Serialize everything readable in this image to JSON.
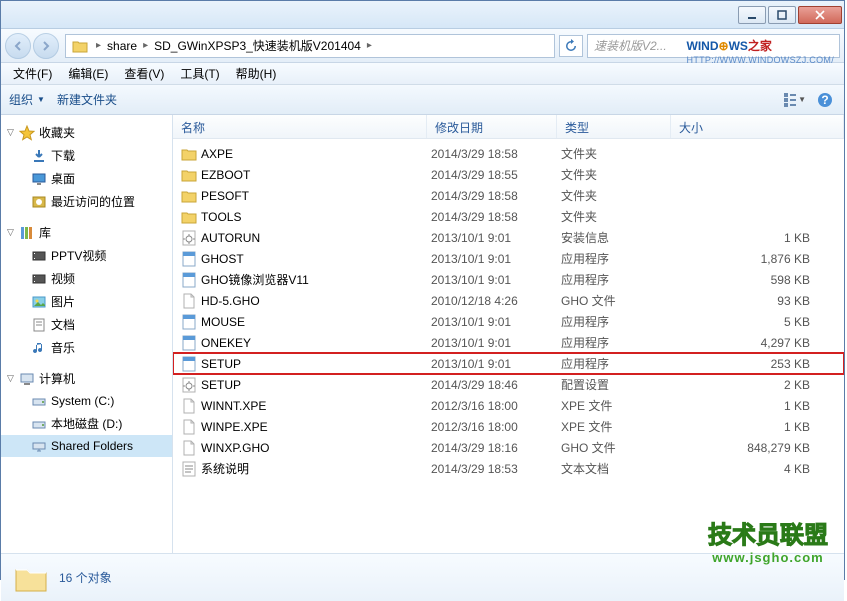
{
  "breadcrumb": {
    "items": [
      "share",
      "SD_GWinXPSP3_快速装机版V201404"
    ],
    "search_placeholder": "速装机版V2..."
  },
  "menubar": [
    "文件(F)",
    "编辑(E)",
    "查看(V)",
    "工具(T)",
    "帮助(H)"
  ],
  "toolbar": {
    "organize": "组织",
    "new_folder": "新建文件夹"
  },
  "sidebar": {
    "groups": [
      {
        "label": "收藏夹",
        "icon": "star",
        "items": [
          {
            "label": "下载",
            "icon": "download"
          },
          {
            "label": "桌面",
            "icon": "desktop"
          },
          {
            "label": "最近访问的位置",
            "icon": "recent"
          }
        ]
      },
      {
        "label": "库",
        "icon": "library",
        "items": [
          {
            "label": "PPTV视频",
            "icon": "video"
          },
          {
            "label": "视频",
            "icon": "video"
          },
          {
            "label": "图片",
            "icon": "picture"
          },
          {
            "label": "文档",
            "icon": "document"
          },
          {
            "label": "音乐",
            "icon": "music"
          }
        ]
      },
      {
        "label": "计算机",
        "icon": "computer",
        "items": [
          {
            "label": "System (C:)",
            "icon": "drive"
          },
          {
            "label": "本地磁盘 (D:)",
            "icon": "drive"
          },
          {
            "label": "Shared Folders",
            "icon": "netdrive",
            "selected": true
          }
        ]
      }
    ]
  },
  "columns": {
    "name": "名称",
    "date": "修改日期",
    "type": "类型",
    "size": "大小"
  },
  "files": [
    {
      "name": "AXPE",
      "date": "2014/3/29 18:58",
      "type": "文件夹",
      "size": "",
      "icon": "folder"
    },
    {
      "name": "EZBOOT",
      "date": "2014/3/29 18:55",
      "type": "文件夹",
      "size": "",
      "icon": "folder"
    },
    {
      "name": "PESOFT",
      "date": "2014/3/29 18:58",
      "type": "文件夹",
      "size": "",
      "icon": "folder"
    },
    {
      "name": "TOOLS",
      "date": "2014/3/29 18:58",
      "type": "文件夹",
      "size": "",
      "icon": "folder"
    },
    {
      "name": "AUTORUN",
      "date": "2013/10/1 9:01",
      "type": "安装信息",
      "size": "1 KB",
      "icon": "config"
    },
    {
      "name": "GHOST",
      "date": "2013/10/1 9:01",
      "type": "应用程序",
      "size": "1,876 KB",
      "icon": "app"
    },
    {
      "name": "GHO镜像浏览器V11",
      "date": "2013/10/1 9:01",
      "type": "应用程序",
      "size": "598 KB",
      "icon": "app"
    },
    {
      "name": "HD-5.GHO",
      "date": "2010/12/18 4:26",
      "type": "GHO 文件",
      "size": "93 KB",
      "icon": "file"
    },
    {
      "name": "MOUSE",
      "date": "2013/10/1 9:01",
      "type": "应用程序",
      "size": "5 KB",
      "icon": "app"
    },
    {
      "name": "ONEKEY",
      "date": "2013/10/1 9:01",
      "type": "应用程序",
      "size": "4,297 KB",
      "icon": "app"
    },
    {
      "name": "SETUP",
      "date": "2013/10/1 9:01",
      "type": "应用程序",
      "size": "253 KB",
      "icon": "app",
      "highlighted": true
    },
    {
      "name": "SETUP",
      "date": "2014/3/29 18:46",
      "type": "配置设置",
      "size": "2 KB",
      "icon": "config"
    },
    {
      "name": "WINNT.XPE",
      "date": "2012/3/16 18:00",
      "type": "XPE 文件",
      "size": "1 KB",
      "icon": "file"
    },
    {
      "name": "WINPE.XPE",
      "date": "2012/3/16 18:00",
      "type": "XPE 文件",
      "size": "1 KB",
      "icon": "file"
    },
    {
      "name": "WINXP.GHO",
      "date": "2014/3/29 18:16",
      "type": "GHO 文件",
      "size": "848,279 KB",
      "icon": "file"
    },
    {
      "name": "系统说明",
      "date": "2014/3/29 18:53",
      "type": "文本文档",
      "size": "4 KB",
      "icon": "txt"
    }
  ],
  "status": {
    "count_label": "16 个对象"
  },
  "watermark_top": {
    "text_prefix": "WIND",
    "text_o": "⊕",
    "text_suffix": "WS",
    "suffix2": "之家",
    "url": "HTTP://WWW.WINDOWSZJ.COM/"
  },
  "watermark_bottom": {
    "text": "技术员联盟",
    "url": "www.jsgho.com"
  }
}
